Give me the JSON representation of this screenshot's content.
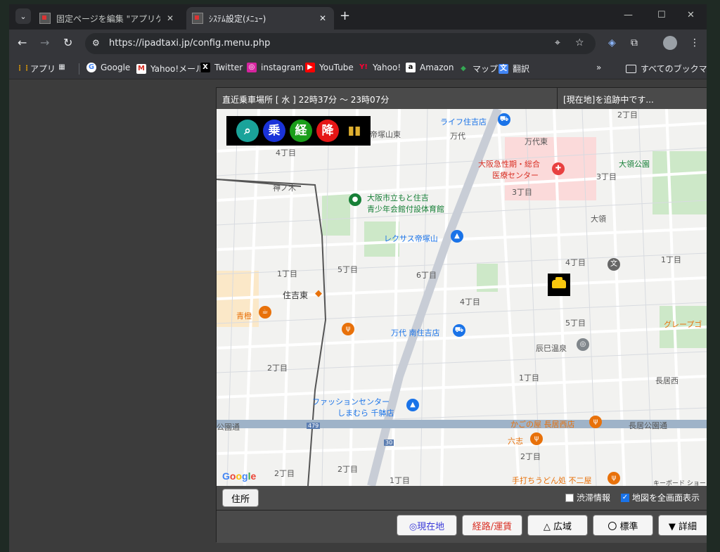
{
  "browser": {
    "tabs": [
      {
        "title": "固定ページを編集 \"アプリケーション\""
      },
      {
        "title": "ｼｽﾃﾑ設定(ﾒﾆｭｰ)"
      }
    ],
    "url": "https://ipadtaxi.jp/config.menu.php"
  },
  "bookmarks": [
    {
      "label": "アプリ",
      "icon": "apps-grid-icon"
    },
    {
      "label": "Google",
      "icon": "google-icon"
    },
    {
      "label": "Yahoo!メール",
      "icon": "yahoo-mail-icon"
    },
    {
      "label": "Twitter",
      "icon": "x-icon"
    },
    {
      "label": "instagram",
      "icon": "instagram-icon"
    },
    {
      "label": "YouTube",
      "icon": "youtube-icon"
    },
    {
      "label": "Yahoo!",
      "icon": "yahoo-icon"
    },
    {
      "label": "Amazon",
      "icon": "amazon-icon"
    },
    {
      "label": "マップ",
      "icon": "maps-icon"
    },
    {
      "label": "翻訳",
      "icon": "translate-icon"
    }
  ],
  "all_bookmarks": "すべてのブックマーク",
  "app": {
    "status_left": "直近乗車場所 [ 水 ] 22時37分 〜 23時07分",
    "status_right": "[現在地]を追跡中です...",
    "icon_buttons": [
      "乗",
      "経",
      "降"
    ],
    "address_button": "住所",
    "traffic_label": "渋滞情報",
    "fullscreen_label": "地図を全画面表示",
    "traffic_checked": false,
    "fullscreen_checked": true,
    "buttons": [
      {
        "label": "◎現在地",
        "color": "#3b3bd9"
      },
      {
        "label": "経路/運賃",
        "color": "#d93025"
      },
      {
        "label": "△ 広域",
        "color": "#000000"
      },
      {
        "label": "〇 標準",
        "color": "#000000"
      },
      {
        "label": "▼ 詳細",
        "color": "#000000"
      }
    ]
  },
  "map": {
    "labels": {
      "raifu": "ライフ住吉店",
      "teizuka": "帝塚山東",
      "mandai": "万代",
      "mandai_higashi": "万代東",
      "hospital": "大阪急性期・総合",
      "hospital2": "医療センター",
      "oyosami_park": "大領公園",
      "chome3a": "3丁目",
      "chome3b": "3丁目",
      "chome4": "4丁目",
      "kamino": "神ノ木",
      "youth1": "大阪市立もと住吉",
      "youth2": "青少年会館付設体育館",
      "lexus": "レクサス帝塚山",
      "oyosami": "大領",
      "chome4b": "4丁目",
      "chome1a": "1丁目",
      "chome5": "5丁目",
      "chome6": "6丁目",
      "chome1b": "1丁目",
      "sumiyoshi_higashi": "住吉東",
      "chome4c": "4丁目",
      "aoto": "青橙",
      "mandai_sumiyoshi": "万代 南住吉店",
      "chome5b": "5丁目",
      "grape": "グレープゴ",
      "tatsumi": "辰巳温泉",
      "chome2a": "2丁目",
      "chome1c": "1丁目",
      "nagai_nishi": "長居西",
      "fashion1": "ファッションセンター",
      "fashion2": "しまむら 千躰店",
      "kagome": "かごの屋 長居西店",
      "koendori": "公園通",
      "nagai_koendori": "長居公園通",
      "rokushi": "六志",
      "chome2b": "2丁目",
      "chome2c": "2丁目",
      "chome2d": "2丁目",
      "chome1d": "1丁目",
      "teuchi": "手打ちうどん処 不二屋",
      "chome2e": "2丁目",
      "route479": "479",
      "route30": "30",
      "keyboard": "キーボード ショー"
    }
  }
}
